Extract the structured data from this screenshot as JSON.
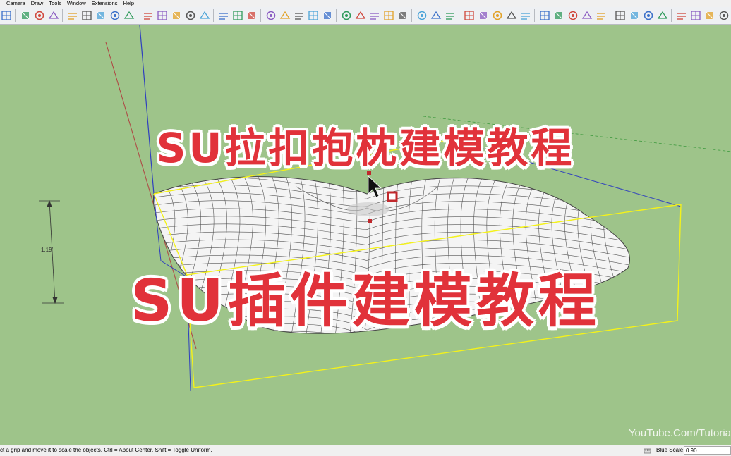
{
  "menu": {
    "items": [
      "Camera",
      "Draw",
      "Tools",
      "Window",
      "Extensions",
      "Help"
    ]
  },
  "toolbar": {
    "icons": [
      "select-icon",
      "top-view-icon",
      "front-view-icon",
      "iso-view-icon",
      "section-plane-icon",
      "section-fill-icon",
      "section-cut-icon",
      "x-ray-icon",
      "back-edges-icon",
      "wireframe-icon",
      "hidden-line-icon",
      "shaded-icon",
      "shaded-texture-icon",
      "monochrome-icon",
      "components-icon",
      "match-photo-icon",
      "warehouse-icon",
      "solid-union-icon",
      "solid-subtract-icon",
      "styles-icon",
      "layers-icon",
      "scenes-icon",
      "paint-icon",
      "eraser-icon",
      "push-pull-icon",
      "move-icon",
      "rotate-icon",
      "scale-icon",
      "follow-me-icon",
      "offset-icon",
      "tape-icon",
      "dimension-icon",
      "protractor-icon",
      "text-icon",
      "axes-icon",
      "orbit-icon",
      "pan-icon",
      "zoom-icon",
      "zoom-extents-icon",
      "walk-icon",
      "look-around-icon",
      "position-camera-icon",
      "previous-view-icon",
      "next-view-icon",
      "add-location-icon",
      "terrain-icon",
      "play-icon",
      "stop-icon",
      "sandbox-icon",
      "smoove-icon"
    ]
  },
  "viewport": {
    "banner_top": "SU拉扣抱枕建模教程",
    "banner_bottom": "SU插件建模教程",
    "dimension_label": "1.19'",
    "watermark": "YouTube.Com/Tutoria"
  },
  "status": {
    "message": "ct a grip and move it to scale the objects. Ctrl = About Center. Shift = Toggle Uniform.",
    "vcb_label": "Blue Scale",
    "vcb_value": "0.90"
  },
  "colors": {
    "background": "#9ec48a",
    "banner_text": "#e1323a",
    "bounding_box": "#f4f21a",
    "axis_blue": "#2f3fbf",
    "axis_red": "#b04040"
  }
}
